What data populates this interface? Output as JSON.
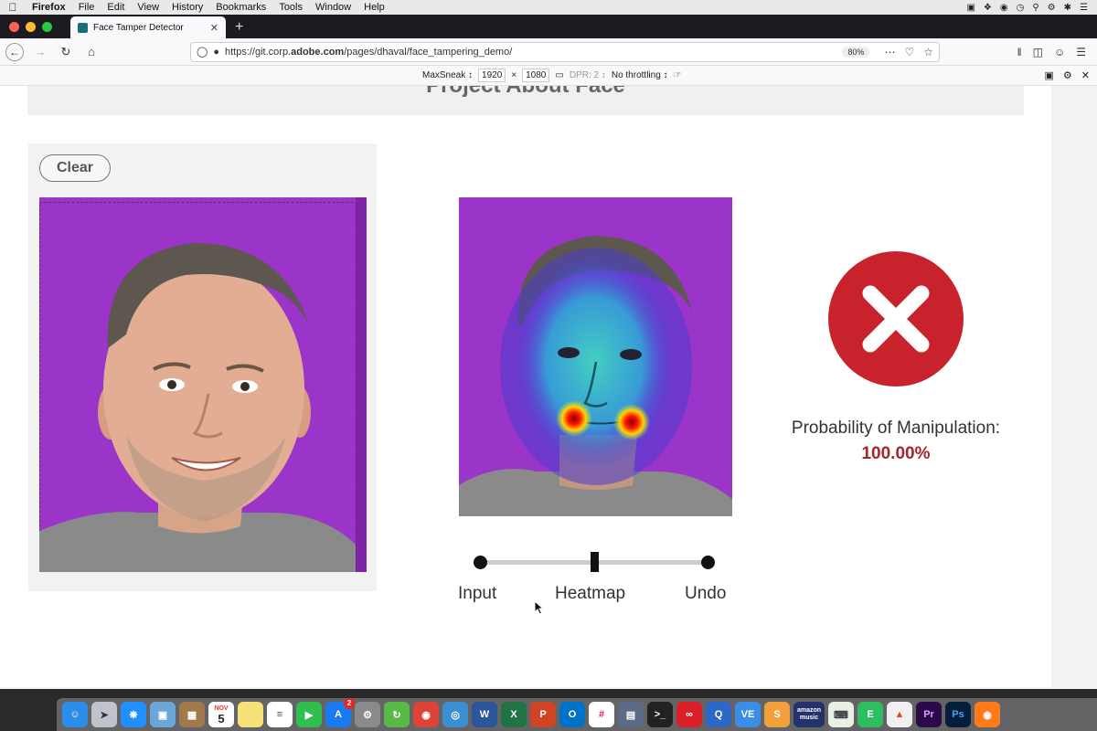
{
  "menubar": {
    "app": "Firefox",
    "items": [
      "File",
      "Edit",
      "View",
      "History",
      "Bookmarks",
      "Tools",
      "Window",
      "Help"
    ]
  },
  "tab": {
    "title": "Face Tamper Detector"
  },
  "navbar": {
    "url_prefix": "https://git.corp.",
    "url_domain": "adobe.com",
    "url_path": "/pages/dhaval/face_tampering_demo/",
    "zoom": "80%"
  },
  "responsive": {
    "device": "MaxSneak",
    "width": "1920",
    "times": "×",
    "height": "1080",
    "dpr": "DPR: 2",
    "throttling": "No throttling"
  },
  "page": {
    "title": "Project About Face",
    "clear_label": "Clear",
    "slider": {
      "labels": [
        "Input",
        "Heatmap",
        "Undo"
      ],
      "position": 0.5
    },
    "result": {
      "probability_label": "Probability of Manipulation:",
      "probability_value": "100.00%",
      "status_color": "#c8232c",
      "value_color": "#a3262a"
    }
  },
  "dock": {
    "calendar_month": "NOV",
    "calendar_day": "5",
    "appstore_badge": "2",
    "word": "W",
    "excel": "X",
    "powerpoint": "P",
    "outlook": "O",
    "ve": "VE",
    "amazon_music_line1": "amazon",
    "amazon_music_line2": "music",
    "premiere": "Pr",
    "photoshop": "Ps"
  },
  "colors": {
    "photo_background": "#9b34c9",
    "accent": "#c8232c"
  }
}
